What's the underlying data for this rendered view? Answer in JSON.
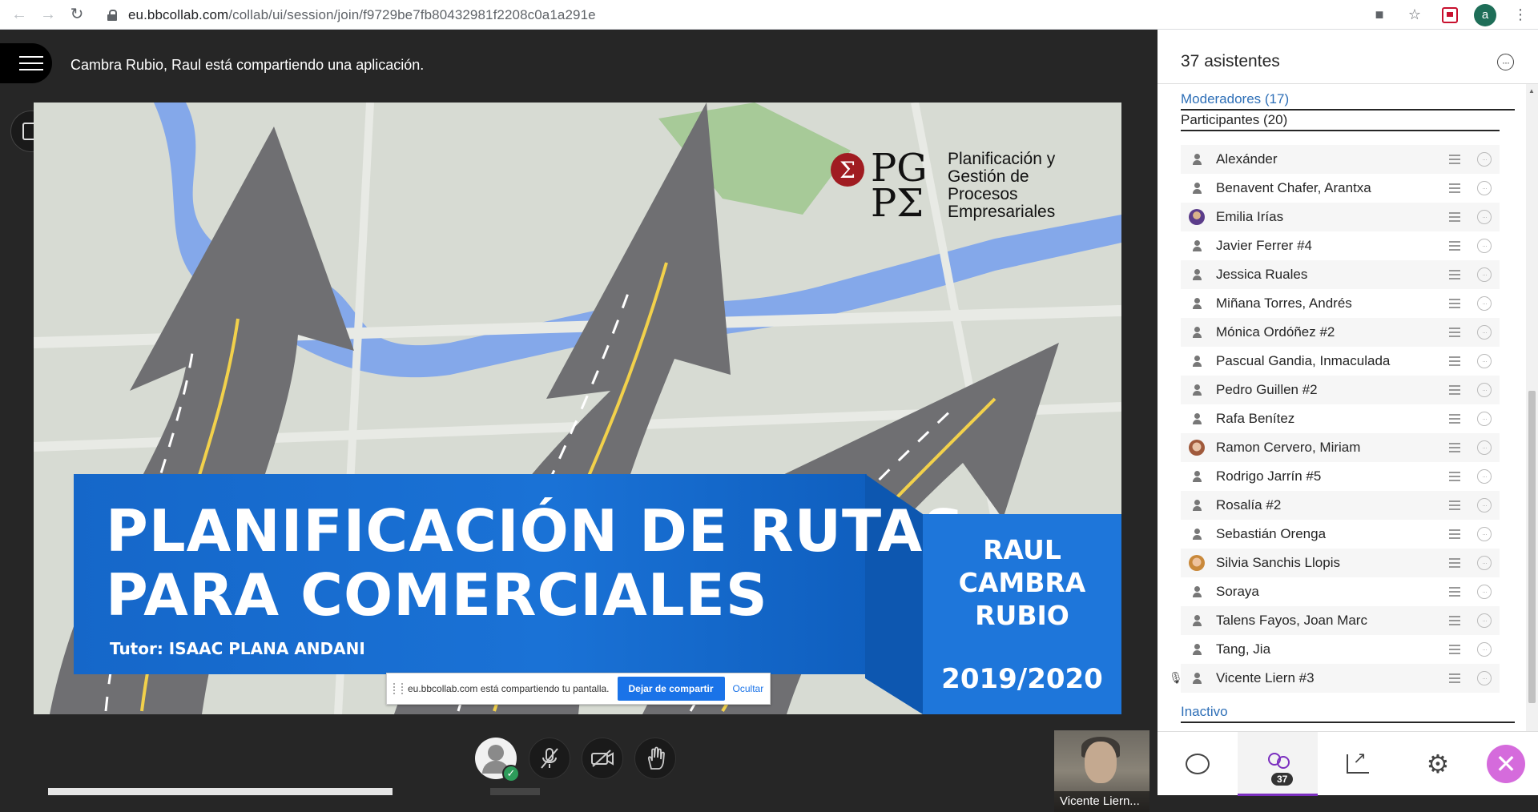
{
  "browser": {
    "url_host": "eu.bbcollab.com",
    "url_path": "/collab/ui/session/join/f9729be7fb80432981f2208c0a1a291e",
    "profile_initial": "a"
  },
  "stage": {
    "share_banner": "Cambra Rubio, Raul está compartiendo una aplicación."
  },
  "slide": {
    "logo_mark": "PG\nPΣ",
    "logo_text": "Planificación y\nGestión de\nProcesos\nEmpresariales",
    "title_line1": "PLANIFICACIÓN DE RUTAS",
    "title_line2": "PARA COMERCIALES",
    "tutor": "Tutor: ISAAC PLANA ANDANI",
    "author": "RAUL\nCAMBRA\nRUBIO",
    "year": "2019/2020"
  },
  "sharebar": {
    "message": "eu.bbcollab.com está compartiendo tu pantalla.",
    "stop_label": "Dejar de compartir",
    "hide_label": "Ocultar"
  },
  "video": {
    "name": "Vicente Liern..."
  },
  "panel": {
    "title": "37 asistentes",
    "moderators": "Moderadores (17)",
    "participants_header": "Participantes (20)",
    "inactive": "Inactivo",
    "badge_count": "37",
    "participants": [
      {
        "name": "Alexánder",
        "avatar": "default"
      },
      {
        "name": "Benavent Chafer, Arantxa",
        "avatar": "default"
      },
      {
        "name": "Emilia Irías",
        "avatar": "photo1"
      },
      {
        "name": "Javier Ferrer #4",
        "avatar": "default"
      },
      {
        "name": "Jessica Ruales",
        "avatar": "default"
      },
      {
        "name": "Miñana Torres, Andrés",
        "avatar": "default"
      },
      {
        "name": "Mónica Ordóñez #2",
        "avatar": "default"
      },
      {
        "name": "Pascual Gandia, Inmaculada",
        "avatar": "default"
      },
      {
        "name": "Pedro Guillen #2",
        "avatar": "default"
      },
      {
        "name": "Rafa Benítez",
        "avatar": "default"
      },
      {
        "name": "Ramon Cervero, Miriam",
        "avatar": "photo2"
      },
      {
        "name": "Rodrigo Jarrín #5",
        "avatar": "default"
      },
      {
        "name": "Rosalía #2",
        "avatar": "default"
      },
      {
        "name": "Sebastián Orenga",
        "avatar": "default"
      },
      {
        "name": "Silvia Sanchis Llopis",
        "avatar": "photo3"
      },
      {
        "name": "Soraya",
        "avatar": "default"
      },
      {
        "name": "Talens Fayos, Joan Marc",
        "avatar": "default"
      },
      {
        "name": "Tang, Jia",
        "avatar": "default"
      },
      {
        "name": "Vicente Liern #3",
        "avatar": "default",
        "mic": true
      }
    ]
  },
  "colors": {
    "accent_purple": "#7b2fbf",
    "link_blue": "#2e6fb7",
    "slide_blue": "#1a72d6",
    "close_pink": "#d56bdc"
  }
}
